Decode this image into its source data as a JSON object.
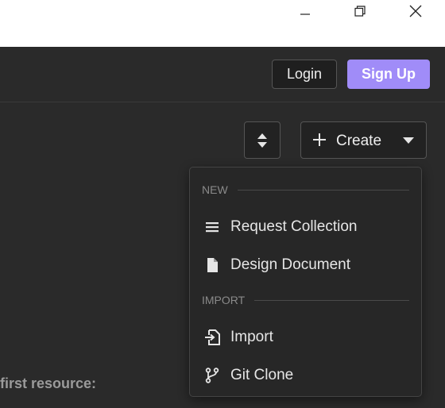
{
  "window": {
    "minimize_icon": "minimize-icon",
    "maximize_icon": "restore-icon",
    "close_icon": "close-icon"
  },
  "header": {
    "login_label": "Login",
    "signup_label": "Sign Up",
    "accent_color": "#a08cf8"
  },
  "toolbar": {
    "sort_icon": "sort-icon",
    "create_label": "Create"
  },
  "dropdown": {
    "new_section": "NEW",
    "import_section": "IMPORT",
    "items": [
      {
        "label": "Request Collection",
        "icon": "list-icon"
      },
      {
        "label": "Design Document",
        "icon": "document-icon"
      },
      {
        "label": "Import",
        "icon": "import-icon"
      },
      {
        "label": "Git Clone",
        "icon": "git-branch-icon"
      }
    ]
  },
  "hint_text": "first resource:"
}
